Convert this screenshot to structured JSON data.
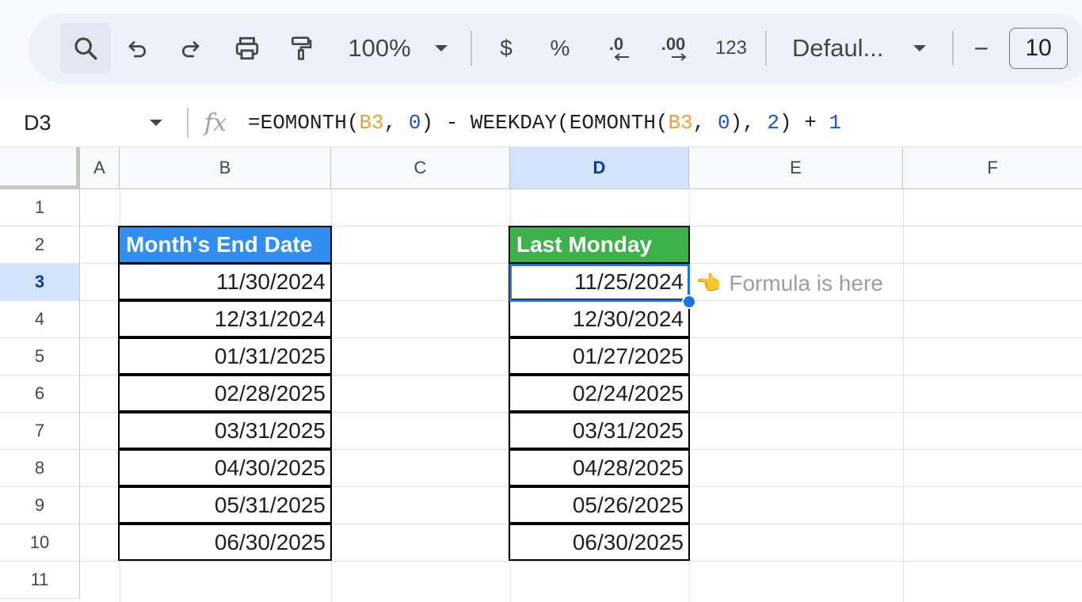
{
  "toolbar": {
    "zoom": "100%",
    "currency": "$",
    "percent": "%",
    "decrease_decimal": ".0",
    "increase_decimal": ".00",
    "number_format": "123",
    "font": "Defaul...",
    "font_size_minus": "−",
    "font_size": "10"
  },
  "formula_bar": {
    "name_box": "D3",
    "fx": "fx",
    "formula_parts": [
      "=EOMONTH(",
      "B3",
      ", ",
      "0",
      ") - WEEKDAY(EOMONTH(",
      "B3",
      ", ",
      "0",
      "), ",
      "2",
      ") + ",
      "1"
    ]
  },
  "columns": [
    "A",
    "B",
    "C",
    "D",
    "E",
    "F"
  ],
  "rows": [
    "1",
    "2",
    "3",
    "4",
    "5",
    "6",
    "7",
    "8",
    "9",
    "10",
    "11"
  ],
  "table_b": {
    "header": "Month's End Date",
    "header_color": "#2f8ef0",
    "values": [
      "11/30/2024",
      "12/31/2024",
      "01/31/2025",
      "02/28/2025",
      "03/31/2025",
      "04/30/2025",
      "05/31/2025",
      "06/30/2025"
    ]
  },
  "table_d": {
    "header": "Last Monday",
    "header_color": "#3cb24a",
    "values": [
      "11/25/2024",
      "12/30/2024",
      "01/27/2025",
      "02/24/2025",
      "03/31/2025",
      "04/28/2025",
      "05/26/2025",
      "06/30/2025"
    ]
  },
  "annotation": {
    "pointer_icon": "👈",
    "text": "Formula is here"
  },
  "colors": {
    "selection": "#1a73e8",
    "selected_header_bg": "#d3e3fd"
  }
}
